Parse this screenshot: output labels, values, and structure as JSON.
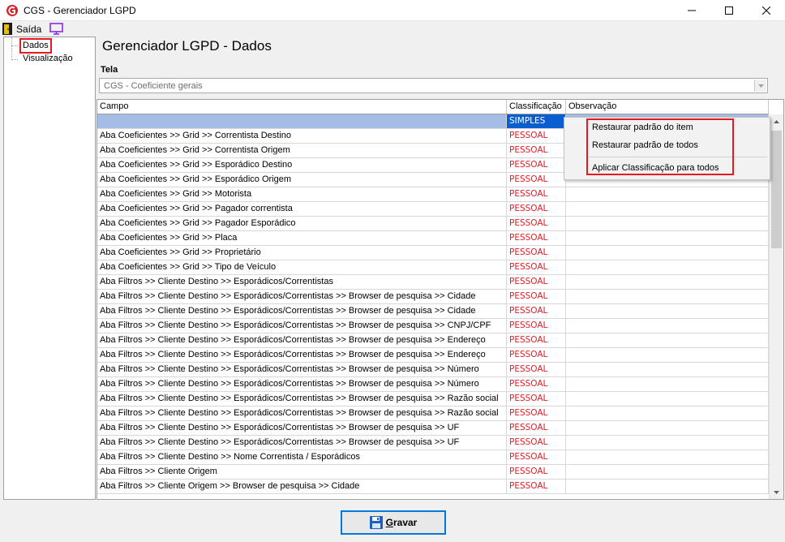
{
  "window": {
    "title": "CGS - Gerenciador LGPD"
  },
  "menu": {
    "exit_label": "Saída"
  },
  "tree": {
    "items": [
      {
        "label": "Dados",
        "selected": true
      },
      {
        "label": "Visualização",
        "selected": false
      }
    ]
  },
  "main": {
    "heading": "Gerenciador LGPD - Dados",
    "tela_label": "Tela",
    "tela_value": "CGS - Coeficiente gerais"
  },
  "grid": {
    "columns": [
      "Campo",
      "Classificação",
      "Observação"
    ],
    "rows": [
      {
        "campo": "",
        "classificacao": "SIMPLES",
        "observacao": "",
        "selected": true
      },
      {
        "campo": "Aba Coeficientes >> Grid >> Correntista Destino",
        "classificacao": "PESSOAL",
        "observacao": ""
      },
      {
        "campo": "Aba Coeficientes >> Grid >> Correntista Origem",
        "classificacao": "PESSOAL",
        "observacao": ""
      },
      {
        "campo": "Aba Coeficientes >> Grid >> Esporádico Destino",
        "classificacao": "PESSOAL",
        "observacao": ""
      },
      {
        "campo": "Aba Coeficientes >> Grid >> Esporádico Origem",
        "classificacao": "PESSOAL",
        "observacao": ""
      },
      {
        "campo": "Aba Coeficientes >> Grid >> Motorista",
        "classificacao": "PESSOAL",
        "observacao": ""
      },
      {
        "campo": "Aba Coeficientes >> Grid >> Pagador correntista",
        "classificacao": "PESSOAL",
        "observacao": ""
      },
      {
        "campo": "Aba Coeficientes >> Grid >> Pagador Esporádico",
        "classificacao": "PESSOAL",
        "observacao": ""
      },
      {
        "campo": "Aba Coeficientes >> Grid >> Placa",
        "classificacao": "PESSOAL",
        "observacao": ""
      },
      {
        "campo": "Aba Coeficientes >> Grid >> Proprietário",
        "classificacao": "PESSOAL",
        "observacao": ""
      },
      {
        "campo": "Aba Coeficientes >> Grid >> Tipo de Veículo",
        "classificacao": "PESSOAL",
        "observacao": ""
      },
      {
        "campo": "Aba Filtros >> Cliente Destino >> Esporádicos/Correntistas",
        "classificacao": "PESSOAL",
        "observacao": ""
      },
      {
        "campo": "Aba Filtros >> Cliente Destino >> Esporádicos/Correntistas >> Browser de pesquisa >> Cidade",
        "classificacao": "PESSOAL",
        "observacao": ""
      },
      {
        "campo": "Aba Filtros >> Cliente Destino >> Esporádicos/Correntistas >> Browser de pesquisa >> Cidade",
        "classificacao": "PESSOAL",
        "observacao": ""
      },
      {
        "campo": "Aba Filtros >> Cliente Destino >> Esporádicos/Correntistas >> Browser de pesquisa >> CNPJ/CPF",
        "classificacao": "PESSOAL",
        "observacao": ""
      },
      {
        "campo": "Aba Filtros >> Cliente Destino >> Esporádicos/Correntistas >> Browser de pesquisa >> Endereço",
        "classificacao": "PESSOAL",
        "observacao": ""
      },
      {
        "campo": "Aba Filtros >> Cliente Destino >> Esporádicos/Correntistas >> Browser de pesquisa >> Endereço",
        "classificacao": "PESSOAL",
        "observacao": ""
      },
      {
        "campo": "Aba Filtros >> Cliente Destino >> Esporádicos/Correntistas >> Browser de pesquisa >> Número",
        "classificacao": "PESSOAL",
        "observacao": ""
      },
      {
        "campo": "Aba Filtros >> Cliente Destino >> Esporádicos/Correntistas >> Browser de pesquisa >> Número",
        "classificacao": "PESSOAL",
        "observacao": ""
      },
      {
        "campo": "Aba Filtros >> Cliente Destino >> Esporádicos/Correntistas >> Browser de pesquisa >> Razão social",
        "classificacao": "PESSOAL",
        "observacao": ""
      },
      {
        "campo": "Aba Filtros >> Cliente Destino >> Esporádicos/Correntistas >> Browser de pesquisa >> Razão social",
        "classificacao": "PESSOAL",
        "observacao": ""
      },
      {
        "campo": "Aba Filtros >> Cliente Destino >> Esporádicos/Correntistas >> Browser de pesquisa >> UF",
        "classificacao": "PESSOAL",
        "observacao": ""
      },
      {
        "campo": "Aba Filtros >> Cliente Destino >> Esporádicos/Correntistas >> Browser de pesquisa >> UF",
        "classificacao": "PESSOAL",
        "observacao": ""
      },
      {
        "campo": "Aba Filtros >> Cliente Destino >> Nome Correntista / Esporádicos",
        "classificacao": "PESSOAL",
        "observacao": ""
      },
      {
        "campo": "Aba Filtros >> Cliente Origem",
        "classificacao": "PESSOAL",
        "observacao": ""
      },
      {
        "campo": "Aba Filtros >> Cliente Origem >> Browser de pesquisa >> Cidade",
        "classificacao": "PESSOAL",
        "observacao": ""
      }
    ]
  },
  "context_menu": {
    "items": [
      "Restaurar padrão do item",
      "Restaurar padrão de todos",
      "Aplicar Classificação para todos"
    ]
  },
  "footer": {
    "save_prefix": "G",
    "save_rest": "ravar"
  },
  "colors": {
    "accent": "#0078d7",
    "personal_text": "#e31b23",
    "selected_row": "#a4bce6",
    "selected_cell": "#0a5fd0",
    "highlight_box": "#e31b23"
  },
  "icons": [
    "app-logo-icon",
    "minimize-icon",
    "maximize-icon",
    "close-icon",
    "exit-door-icon",
    "monitor-icon",
    "dropdown-arrow-icon",
    "scroll-up-icon",
    "scroll-down-icon",
    "save-disk-icon"
  ]
}
